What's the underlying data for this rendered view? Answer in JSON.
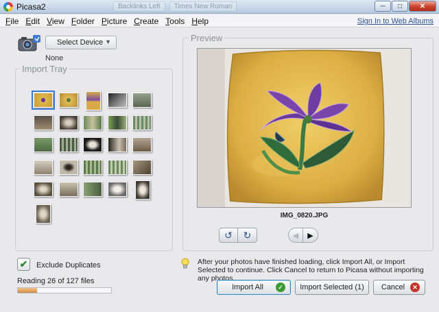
{
  "window": {
    "title": "Picasa2",
    "ghost_tabs": [
      "Backlinks Left",
      "Times New Roman"
    ]
  },
  "menu": [
    "File",
    "Edit",
    "View",
    "Folder",
    "Picture",
    "Create",
    "Tools",
    "Help"
  ],
  "signin_link": "Sign In to Web Albums",
  "device": {
    "select_label": "Select Device",
    "status": "None"
  },
  "import_tray": {
    "title": "Import Tray"
  },
  "preview": {
    "title": "Preview",
    "filename": "IMG_0820.JPG"
  },
  "options": {
    "exclude_duplicates_label": "Exclude Duplicates",
    "exclude_duplicates_checked": true
  },
  "progress": {
    "text": "Reading 26 of 127 files",
    "fraction": 0.205
  },
  "info_text": "After your photos have finished loading, click Import All, or Import Selected to continue. Click Cancel to return to Picasa without importing any photos.",
  "buttons": {
    "import_all": "Import All",
    "import_selected": "Import Selected (1)",
    "cancel": "Cancel"
  },
  "icons": {
    "rotate_left": "rotate-left-icon",
    "rotate_right": "rotate-right-icon",
    "prev": "prev-arrow-icon",
    "next": "next-arrow-icon"
  },
  "colors": {
    "accent": "#3b7bd4",
    "progress": "#d28a3a",
    "pillow_yellow": "#e0b84a",
    "flower_purple": "#6a3a9a",
    "leaf_green": "#2f6b3c"
  }
}
